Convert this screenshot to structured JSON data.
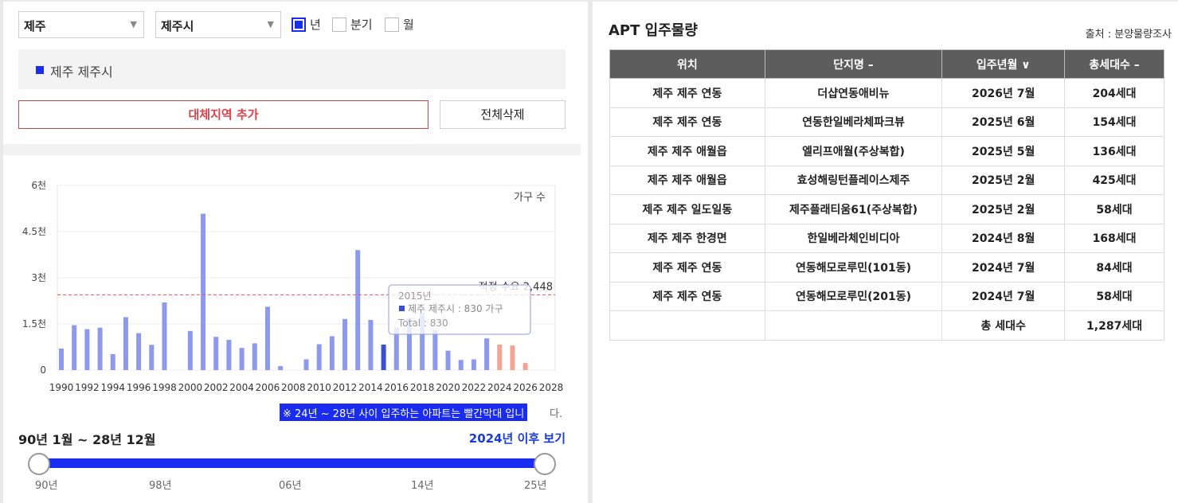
{
  "filters": {
    "province": "제주",
    "city": "제주시",
    "period_options": [
      {
        "label": "년",
        "checked": true
      },
      {
        "label": "분기",
        "checked": false
      },
      {
        "label": "월",
        "checked": false
      }
    ]
  },
  "region_tag": "제주 제주시",
  "buttons": {
    "add_region": "대체지역 추가",
    "delete_all": "전체삭제"
  },
  "chart_data": {
    "type": "bar",
    "unit_label": "가구 수",
    "y_ticks": [
      "0",
      "1.5천",
      "3천",
      "4.5천",
      "6천"
    ],
    "ylim": [
      0,
      6000
    ],
    "x_tick_labels": [
      "1990",
      "1992",
      "1994",
      "1996",
      "1998",
      "2000",
      "2002",
      "2004",
      "2006",
      "2008",
      "2010",
      "2012",
      "2014",
      "2016",
      "2018",
      "2020",
      "2022",
      "2024",
      "2026",
      "2028"
    ],
    "categories": [
      1990,
      1991,
      1992,
      1993,
      1994,
      1995,
      1996,
      1997,
      1998,
      1999,
      2000,
      2001,
      2002,
      2003,
      2004,
      2005,
      2006,
      2007,
      2008,
      2009,
      2010,
      2011,
      2012,
      2013,
      2014,
      2015,
      2016,
      2017,
      2018,
      2019,
      2020,
      2021,
      2022,
      2023,
      2024,
      2025,
      2026,
      2027,
      2028
    ],
    "values": [
      700,
      1460,
      1330,
      1380,
      520,
      1720,
      1200,
      820,
      2200,
      0,
      1270,
      5080,
      1080,
      980,
      720,
      870,
      2060,
      130,
      0,
      350,
      840,
      1100,
      1660,
      3900,
      1630,
      830,
      1380,
      1700,
      1860,
      1300,
      630,
      330,
      350,
      1030,
      830,
      800,
      230,
      0,
      0
    ],
    "forecast_from": 2024,
    "reference_line": {
      "label": "적정 수요 2,448",
      "value": 2448
    },
    "tooltip": {
      "title": "2015년",
      "series": "제주 제주시 : 830 가구",
      "total": "Total : 830",
      "category": 2015
    },
    "colors": {
      "bar": "#8d99ea",
      "highlight": "#3a4fd6",
      "forecast": "#f0a596",
      "reference": "#e8555a"
    }
  },
  "note": "※ 24년 ~ 28년 사이 입주하는 아파트는 빨간막대 입니",
  "note_tail": "다.",
  "range": {
    "label": "90년 1월 ~ 28년 12월",
    "after_link": "2024년 이후 보기",
    "ticks": [
      "90년",
      "98년",
      "06년",
      "14년",
      "25년"
    ]
  },
  "right": {
    "title": "APT 입주물량",
    "source": "출처 : 분양물량조사",
    "columns": [
      "위치",
      "단지명 –",
      "입주년월 ∨",
      "총세대수 –"
    ],
    "rows": [
      [
        "제주 제주 연동",
        "더샵연동애비뉴",
        "2026년 7월",
        "204세대"
      ],
      [
        "제주 제주 연동",
        "연동한일베라체파크뷰",
        "2025년 6월",
        "154세대"
      ],
      [
        "제주 제주 애월읍",
        "엘리프애월(주상복합)",
        "2025년 5월",
        "136세대"
      ],
      [
        "제주 제주 애월읍",
        "효성해링턴플레이스제주",
        "2025년 2월",
        "425세대"
      ],
      [
        "제주 제주 일도일동",
        "제주플래티움61(주상복합)",
        "2025년 2월",
        "58세대"
      ],
      [
        "제주 제주 한경면",
        "한일베라체인비디아",
        "2024년 8월",
        "168세대"
      ],
      [
        "제주 제주 연동",
        "연동해모로루민(101동)",
        "2024년 7월",
        "84세대"
      ],
      [
        "제주 제주 연동",
        "연동해모로루민(201동)",
        "2024년 7월",
        "58세대"
      ]
    ],
    "total_label": "총 세대수",
    "total_value": "1,287세대"
  }
}
